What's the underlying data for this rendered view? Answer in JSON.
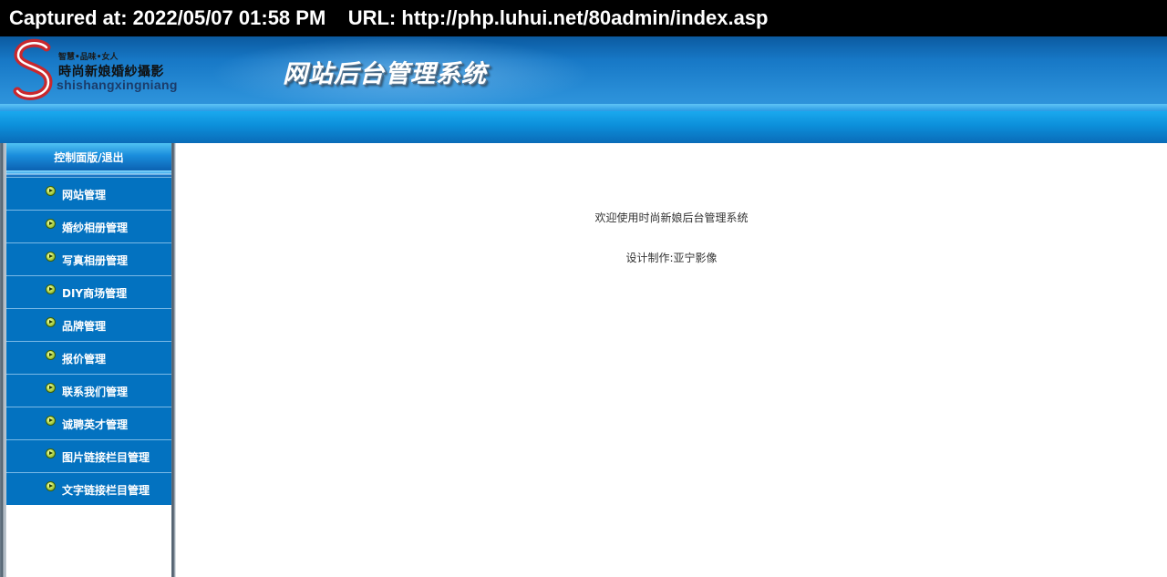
{
  "capture": {
    "text": "Captured at: 2022/05/07 01:58 PM    URL: http://php.luhui.net/80admin/index.asp"
  },
  "header": {
    "logo": {
      "tagline": "智慧•品味•女人",
      "name": "時尚新娘婚紗攝影",
      "pinyin": "shishangxingniang"
    },
    "title": "网站后台管理系统"
  },
  "sidebar": {
    "header": "控制面版/退出",
    "icon": "arrow-right-circle-icon",
    "items": [
      {
        "label": "网站管理"
      },
      {
        "label": "婚纱相册管理"
      },
      {
        "label": "写真相册管理"
      },
      {
        "label": "DIY商场管理"
      },
      {
        "label": "品牌管理"
      },
      {
        "label": "报价管理"
      },
      {
        "label": "联系我们管理"
      },
      {
        "label": "诚聘英才管理"
      },
      {
        "label": "图片链接栏目管理"
      },
      {
        "label": "文字链接栏目管理"
      }
    ]
  },
  "main": {
    "welcome": "欢迎使用时尚新娘后台管理系统",
    "credit": "设计制作:亚宁影像"
  },
  "colors": {
    "menu_bg": "#0372c0",
    "header_bg": "#1778c6",
    "capture_bg": "#000000"
  }
}
